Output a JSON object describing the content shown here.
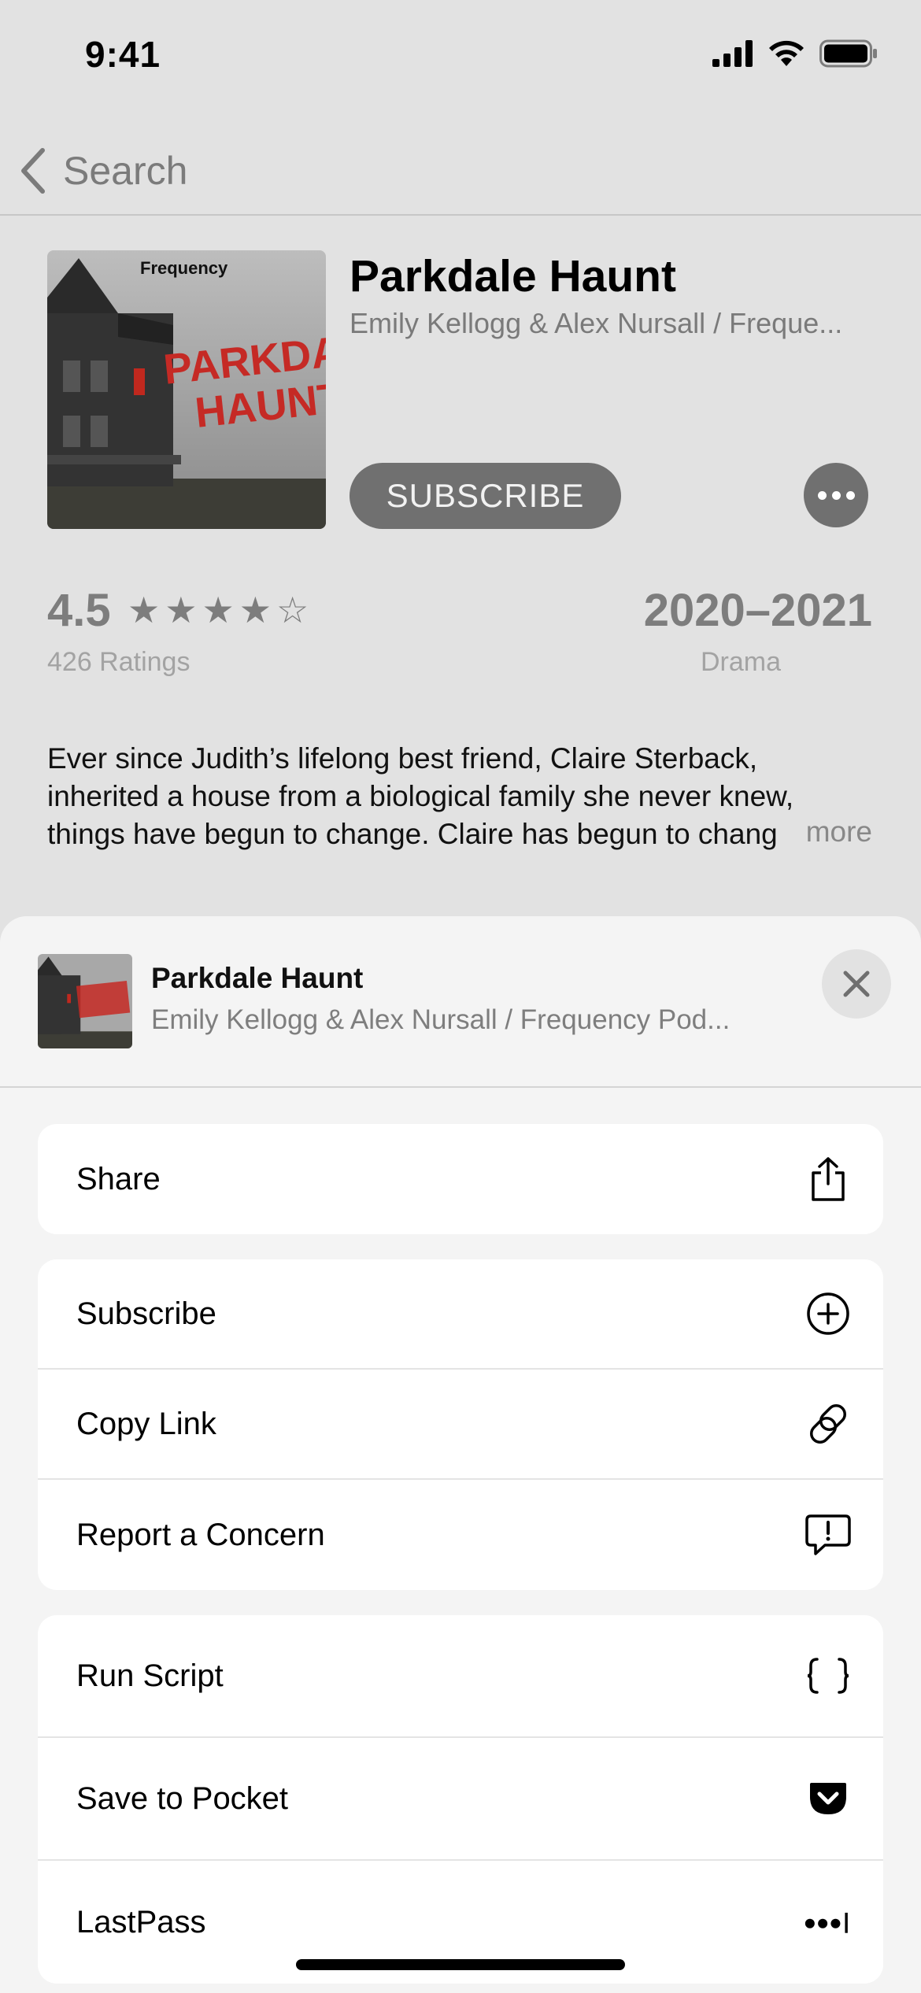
{
  "status_bar": {
    "time": "9:41"
  },
  "nav": {
    "back_label": "Search"
  },
  "podcast": {
    "title": "Parkdale Haunt",
    "author": "Emily Kellogg & Alex Nursall / Freque...",
    "subscribe_label": "SUBSCRIBE",
    "rating": "4.5",
    "stars": "★★★★☆",
    "rating_count": "426 Ratings",
    "years": "2020–2021",
    "genre": "Drama",
    "description": "Ever since Judith’s lifelong best friend, Claire Sterback, inherited a house from a biological family she never knew, things have begun to change. Claire has begun to chang",
    "description_more": "more",
    "artwork": {
      "brand": "Frequency",
      "line1": "PARKDALE",
      "line2": "HAUNT"
    }
  },
  "sheet": {
    "title": "Parkdale Haunt",
    "subtitle": "Emily Kellogg & Alex Nursall / Frequency Pod...",
    "groups": [
      [
        {
          "label": "Share",
          "icon": "share-icon"
        }
      ],
      [
        {
          "label": "Subscribe",
          "icon": "plus-circle-icon"
        },
        {
          "label": "Copy Link",
          "icon": "link-icon"
        },
        {
          "label": "Report a Concern",
          "icon": "exclamation-bubble-icon"
        }
      ],
      [
        {
          "label": "Run Script",
          "icon": "braces-icon"
        },
        {
          "label": "Save to Pocket",
          "icon": "pocket-icon"
        },
        {
          "label": "LastPass",
          "icon": "lastpass-icon"
        }
      ]
    ]
  }
}
